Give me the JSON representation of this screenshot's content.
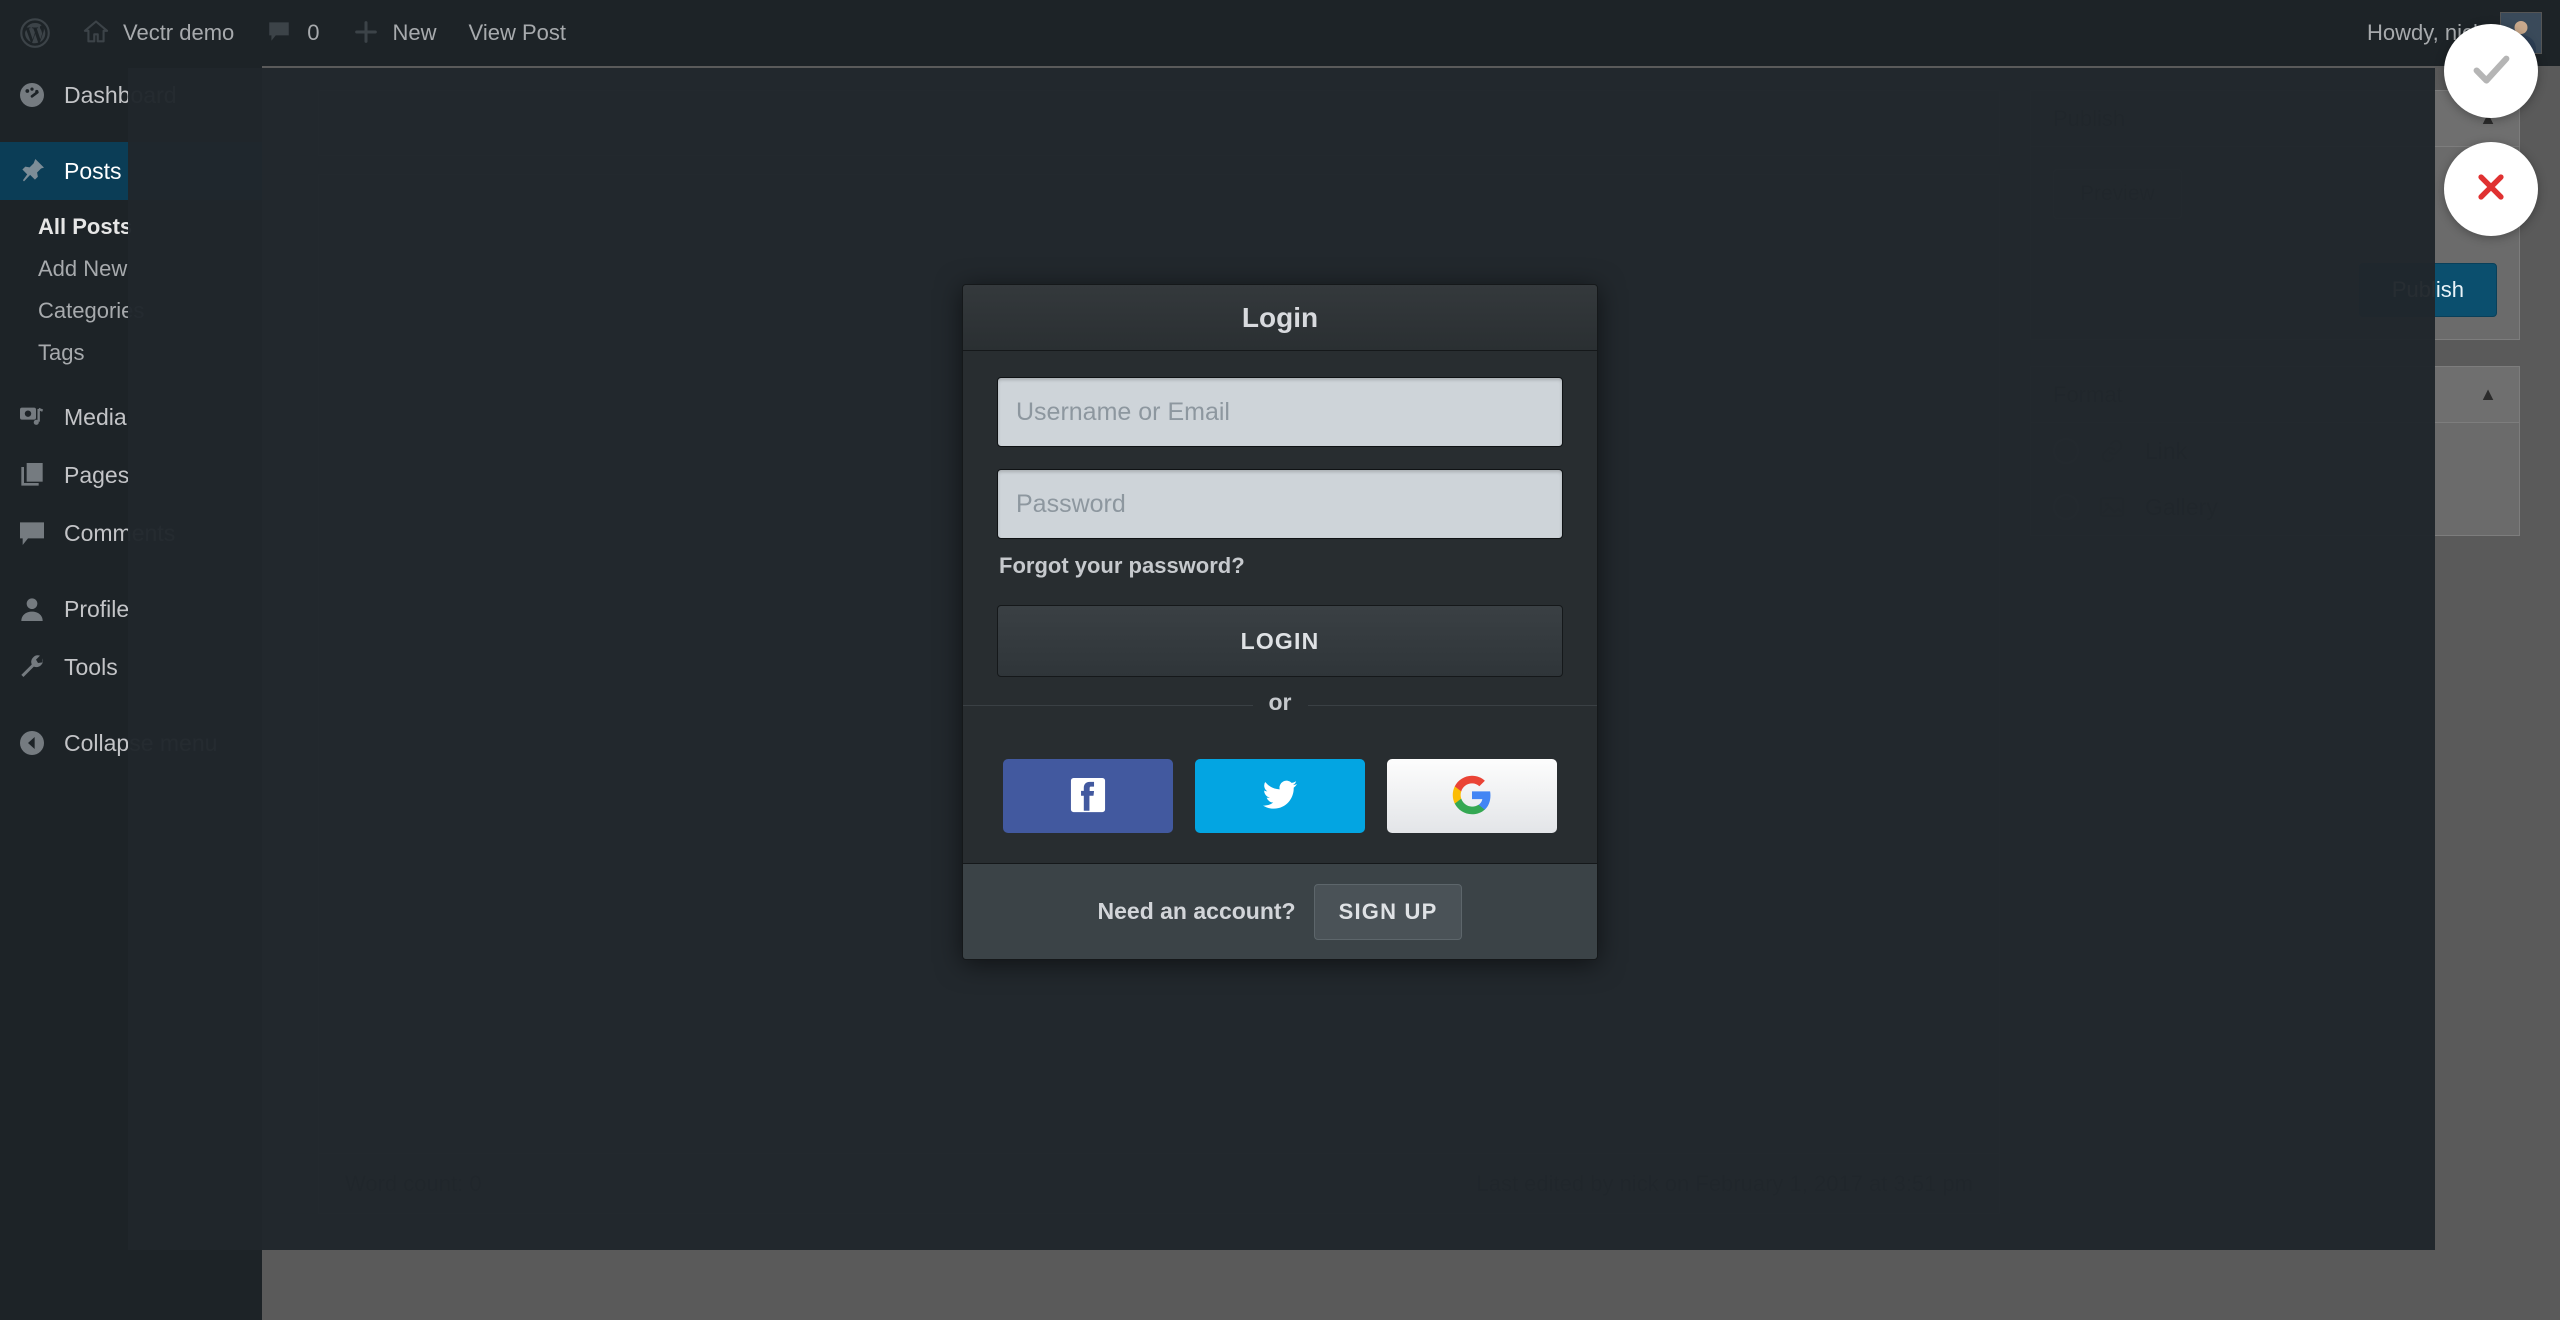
{
  "admin_bar": {
    "logo_icon": "wordpress-logo-icon",
    "site_icon": "home-icon",
    "site_name": "Vectr demo",
    "comments_icon": "comment-bubble-icon",
    "comments_count": "0",
    "new_icon": "plus-icon",
    "new_label": "New",
    "view_post_label": "View Post",
    "howdy": "Howdy, nick",
    "avatar": "user-avatar"
  },
  "admin_menu": {
    "items": [
      {
        "label": "Dashboard",
        "icon": "dashboard-icon",
        "current": false
      },
      {
        "label": "Posts",
        "icon": "pin-icon",
        "current": true
      }
    ],
    "posts_submenu": [
      {
        "label": "All Posts",
        "current": true
      },
      {
        "label": "Add New",
        "current": false
      },
      {
        "label": "Categories",
        "current": false
      },
      {
        "label": "Tags",
        "current": false
      }
    ],
    "items_lower": [
      {
        "label": "Media",
        "icon": "media-icon"
      },
      {
        "label": "Pages",
        "icon": "pages-icon"
      },
      {
        "label": "Comments",
        "icon": "comment-bubble-icon"
      },
      {
        "label": "Profile",
        "icon": "user-icon"
      },
      {
        "label": "Tools",
        "icon": "wrench-icon"
      },
      {
        "label": "Collapse menu",
        "icon": "collapse-arrow-icon"
      }
    ]
  },
  "editor": {
    "word_count": "Word count: 0",
    "last_edited": "Last edited by nick on February 1, 2017 at 3:51 pm",
    "publish_box": {
      "title": "Publish",
      "collapse_icon": "triangle-up-icon",
      "preview_label": "Preview",
      "publish_label": "Publish"
    },
    "format_box": {
      "title": "Format",
      "collapse_icon": "triangle-up-icon",
      "options": [
        {
          "label": "Link",
          "icon": "link-icon"
        },
        {
          "label": "Gallery",
          "icon": "gallery-icon"
        }
      ]
    }
  },
  "login_modal": {
    "title": "Login",
    "username_placeholder": "Username or Email",
    "username_value": "",
    "password_placeholder": "Password",
    "password_value": "",
    "forgot_label": "Forgot your password?",
    "login_button": "LOGIN",
    "divider_label": "or",
    "social": [
      {
        "name": "facebook-icon",
        "label": "Facebook",
        "color": "#42599f"
      },
      {
        "name": "twitter-icon",
        "label": "Twitter",
        "color": "#03a5e2"
      },
      {
        "name": "google-icon",
        "label": "Google",
        "color": "#ffffff"
      }
    ],
    "footer_text": "Need an account?",
    "signup_button": "SIGN UP"
  },
  "floating_buttons": [
    {
      "name": "confirm-check-button",
      "glyph": "check",
      "color": "#b5b5b5"
    },
    {
      "name": "cancel-close-button",
      "glyph": "cross",
      "color": "#e03131"
    }
  ]
}
